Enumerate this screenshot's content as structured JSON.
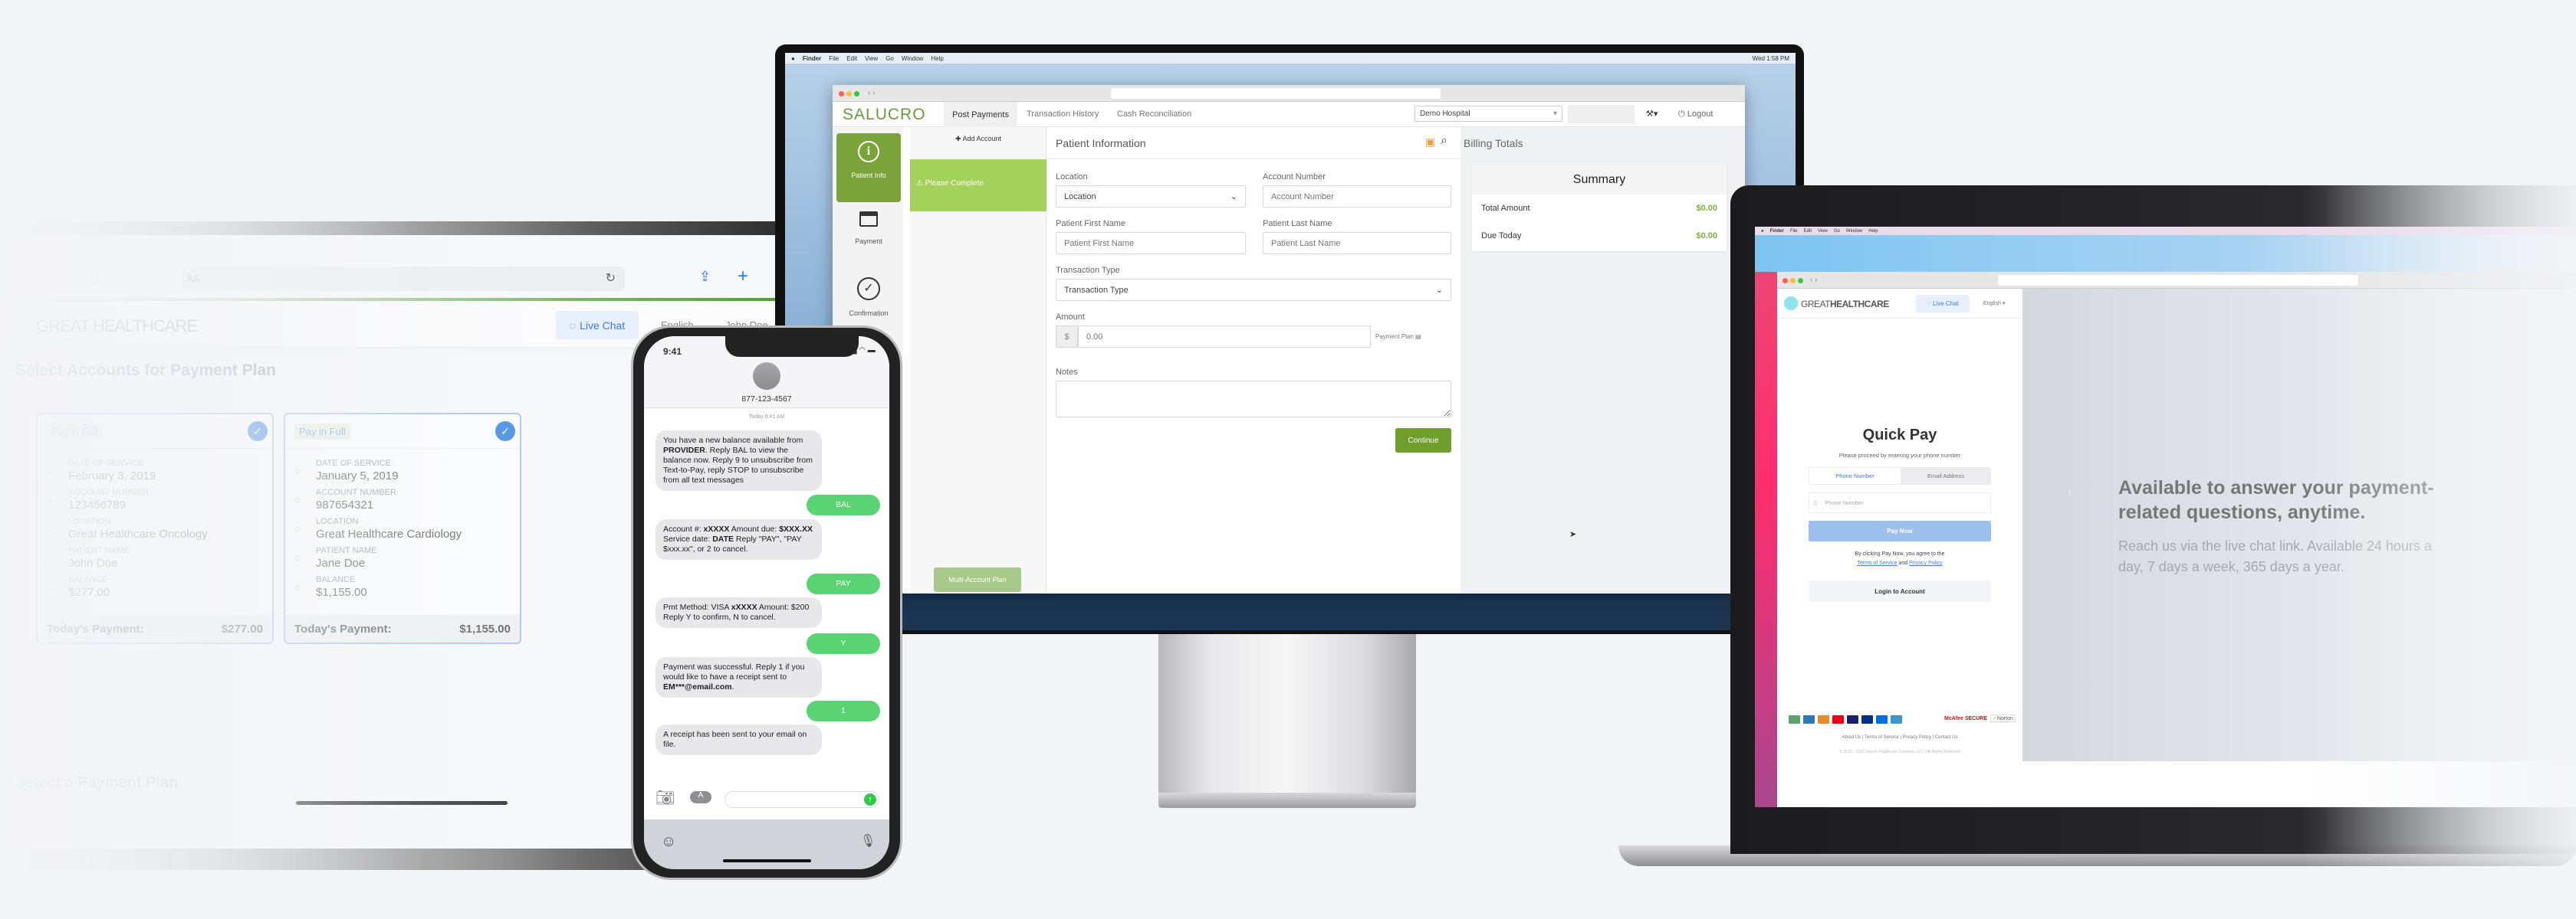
{
  "tablet": {
    "address_bar": "AA",
    "brand": "GREAT HEALTHCARE",
    "live_chat": "Live Chat",
    "language": "English",
    "user": "John Doe",
    "title": "Select Accounts for Payment Plan",
    "section2_title": "Select a Payment Plan",
    "accent": "#4a9d2e",
    "cards": [
      {
        "badge": "Pay in Full",
        "selected": true,
        "fields": [
          {
            "label": "Date of Service",
            "value": "February 3, 2019"
          },
          {
            "label": "Account Number",
            "value": "123456789"
          },
          {
            "label": "Location",
            "value": "Great Healthcare Oncology"
          },
          {
            "label": "Patient Name",
            "value": "John Doe"
          },
          {
            "label": "Balance",
            "value": "$277.00"
          }
        ],
        "footer_label": "Today's Payment:",
        "footer_value": "$277.00"
      },
      {
        "badge": "Pay in Full",
        "selected": true,
        "fields": [
          {
            "label": "Date of Service",
            "value": "January 5, 2019"
          },
          {
            "label": "Account Number",
            "value": "987654321"
          },
          {
            "label": "Location",
            "value": "Great Healthcare Cardiology"
          },
          {
            "label": "Patient Name",
            "value": "Jane Doe"
          },
          {
            "label": "Balance",
            "value": "$1,155.00"
          }
        ],
        "footer_label": "Today's Payment:",
        "footer_value": "$1,155.00"
      }
    ]
  },
  "monitor": {
    "menubar": [
      "Finder",
      "File",
      "Edit",
      "View",
      "Go",
      "Window",
      "Help"
    ],
    "clock": "Wed 1:58 PM",
    "app": {
      "logo": "SALUCRO",
      "tabs": [
        {
          "label": "Post Payments",
          "active": true
        },
        {
          "label": "Transaction History",
          "active": false
        },
        {
          "label": "Cash Reconciliation",
          "active": false
        }
      ],
      "facility_select": "Demo Hospital",
      "logout": "Logout",
      "steps": [
        {
          "label": "Patient Info",
          "icon": "info-icon",
          "active": true
        },
        {
          "label": "Payment",
          "icon": "credit-card-icon",
          "active": false
        },
        {
          "label": "Confirmation",
          "icon": "check-circle-icon",
          "active": false
        }
      ],
      "add_account": "Add Account",
      "account_status": "Please Complete",
      "multi_account_plan": "Multi-Account Plan",
      "form_title": "Patient Information",
      "fields": {
        "location": {
          "label": "Location",
          "value": "Location"
        },
        "account_number": {
          "label": "Account Number",
          "placeholder": "Account Number"
        },
        "first_name": {
          "label": "Patient First Name",
          "placeholder": "Patient First Name"
        },
        "last_name": {
          "label": "Patient Last Name",
          "placeholder": "Patient Last Name"
        },
        "transaction_type": {
          "label": "Transaction Type",
          "value": "Transaction Type"
        },
        "amount": {
          "label": "Amount",
          "prefix": "$",
          "placeholder": "0.00",
          "addon": "Payment Plan"
        },
        "notes": {
          "label": "Notes"
        }
      },
      "continue": "Continue",
      "billing_title": "Billing Totals",
      "summary": {
        "title": "Summary",
        "rows": [
          {
            "label": "Total Amount",
            "value": "$0.00"
          },
          {
            "label": "Due Today",
            "value": "$0.00"
          }
        ]
      },
      "brand_green": "#6f9e2c"
    }
  },
  "phone": {
    "time": "9:41",
    "contact": "877-123-4567",
    "timestamp": "Today 9:41 AM",
    "messages": [
      {
        "dir": "in",
        "parts": [
          {
            "t": "You have a new balance available from "
          },
          {
            "t": "PROVIDER",
            "b": true
          },
          {
            "t": ". Reply BAL to view the balance now. Reply 9 to unsubscribe from Text-to-Pay, reply STOP to unsubscribe from all text messages"
          }
        ]
      },
      {
        "dir": "out",
        "parts": [
          {
            "t": "BAL"
          }
        ]
      },
      {
        "dir": "in",
        "parts": [
          {
            "t": "Account #: "
          },
          {
            "t": "xXXXX",
            "b": true
          },
          {
            "t": " Amount due: "
          },
          {
            "t": "$XXX.XX",
            "b": true
          },
          {
            "t": " Service date: "
          },
          {
            "t": "DATE",
            "b": true
          },
          {
            "t": " Reply \"PAY\", \"PAY $xxx.xx\", or 2 to cancel."
          }
        ]
      },
      {
        "dir": "out",
        "parts": [
          {
            "t": "PAY"
          }
        ]
      },
      {
        "dir": "in",
        "parts": [
          {
            "t": "Pmt Method: VISA "
          },
          {
            "t": "xXXXX",
            "b": true
          },
          {
            "t": " Amount: $200 Reply Y to confirm, N to cancel."
          }
        ]
      },
      {
        "dir": "out",
        "parts": [
          {
            "t": "Y"
          }
        ]
      },
      {
        "dir": "in",
        "parts": [
          {
            "t": "Payment was successful. Reply 1 if you would like to have a receipt sent to "
          },
          {
            "t": "EM***@email.com",
            "b": true
          },
          {
            "t": "."
          }
        ]
      },
      {
        "dir": "out",
        "parts": [
          {
            "t": "1"
          }
        ]
      },
      {
        "dir": "in",
        "parts": [
          {
            "t": "A receipt has been sent to your email on file."
          }
        ]
      }
    ]
  },
  "laptop": {
    "menubar": [
      "Finder",
      "File",
      "Edit",
      "View",
      "Go",
      "Window",
      "Help"
    ],
    "brand_light": "GREAT",
    "brand_bold": "HEALTHCARE",
    "live_chat": "Live Chat",
    "language": "English",
    "title": "Quick Pay",
    "subtitle": "Please proceed by entering your phone number",
    "tabs": [
      {
        "label": "Phone Number",
        "active": true
      },
      {
        "label": "Email Address",
        "active": false
      }
    ],
    "phone_placeholder": "Phone Number",
    "pay_now": "Pay Now",
    "agree_text": "By clicking Pay Now, you agree to the",
    "terms_link": "Terms of Service",
    "and": "and",
    "privacy_link": "Privacy Policy",
    "login": "Login to Account",
    "payment_icons": [
      "ach-icon",
      "amex-icon",
      "discover-icon",
      "mastercard-icon",
      "visa-icon",
      "paypal-icon",
      "paypal-credit-icon",
      "venmo-icon"
    ],
    "security_badges": [
      "McAfee SECURE",
      "Norton"
    ],
    "footer_links": "About Us | Terms of Service | Privacy Policy | Contact Us",
    "copyright": "© 2012 - 2020 Salucro Healthcare Solutions, LLC | All Rights Reserved",
    "headline_1": "Available to answer your payment-",
    "headline_2": "related questions, anytime.",
    "body_1": "Reach us via the live chat link. Available 24 hours a",
    "body_2": "day, 7 days a week, 365 days a year.",
    "link_color": "#3b7ddd"
  }
}
